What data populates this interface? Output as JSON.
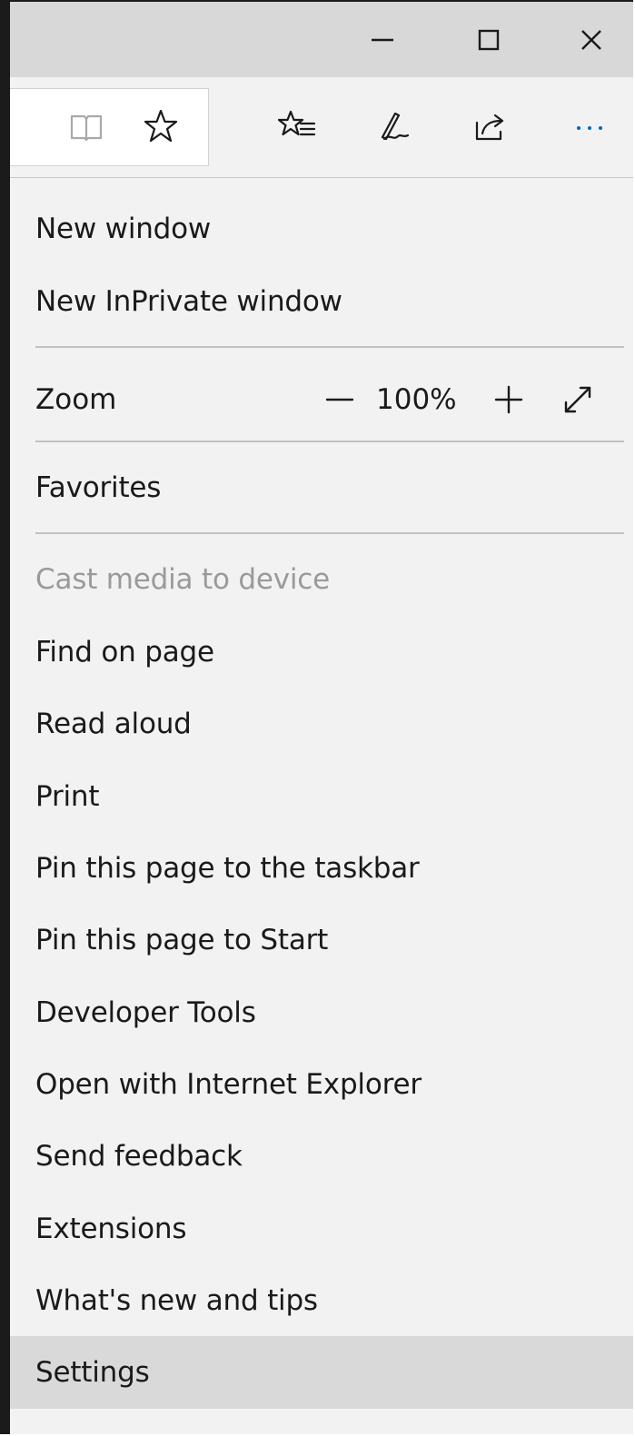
{
  "window_controls": {
    "minimize_icon": "minimize-icon",
    "maximize_icon": "maximize-icon",
    "close_icon": "close-icon"
  },
  "toolbar": {
    "icons": [
      "reading-view-icon",
      "favorite-star-icon",
      "hub-icon",
      "notes-icon",
      "share-icon",
      "more-icon"
    ],
    "accent_color": "#0066c4"
  },
  "menu": {
    "new_window": "New window",
    "new_inprivate_window": "New InPrivate window",
    "zoom_label": "Zoom",
    "zoom_value": "100%",
    "favorites": "Favorites",
    "cast_media": "Cast media to device",
    "find_on_page": "Find on page",
    "read_aloud": "Read aloud",
    "print": "Print",
    "pin_taskbar": "Pin this page to the taskbar",
    "pin_start": "Pin this page to Start",
    "developer_tools": "Developer Tools",
    "open_ie": "Open with Internet Explorer",
    "send_feedback": "Send feedback",
    "extensions": "Extensions",
    "whats_new": "What's new and tips",
    "settings": "Settings"
  }
}
